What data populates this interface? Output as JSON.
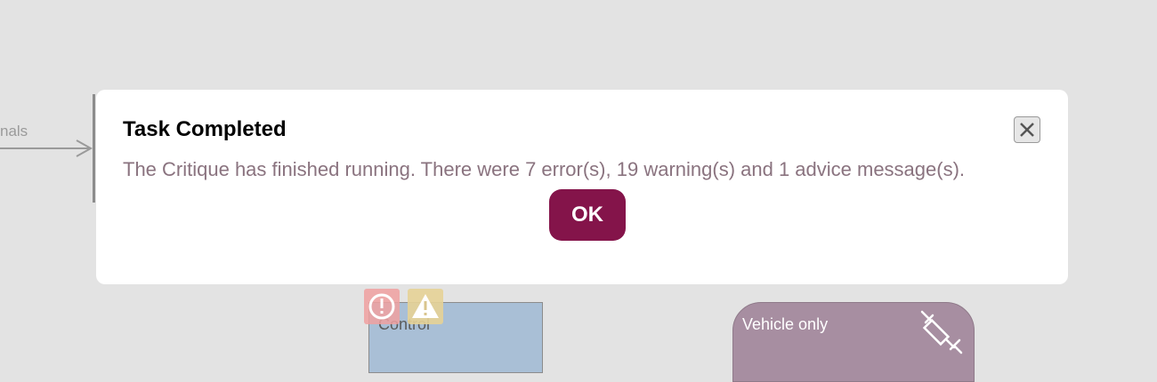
{
  "background_diagram": {
    "edge_label": "nals",
    "control_node": {
      "label": "Control",
      "badges": [
        "error-icon",
        "warning-icon"
      ]
    },
    "vehicle_node": {
      "label": "Vehicle only",
      "icon": "syringe-icon"
    }
  },
  "dialog": {
    "title": "Task Completed",
    "message": "The Critique has finished running. There were 7 error(s), 19 warning(s) and 1 advice message(s).",
    "ok_label": "OK",
    "close_icon": "close-icon"
  },
  "colors": {
    "ok_button": "#84144a",
    "message_text": "#8a737f",
    "vehicle_node": "#a78ea1",
    "control_node": "#a9bfd6"
  }
}
